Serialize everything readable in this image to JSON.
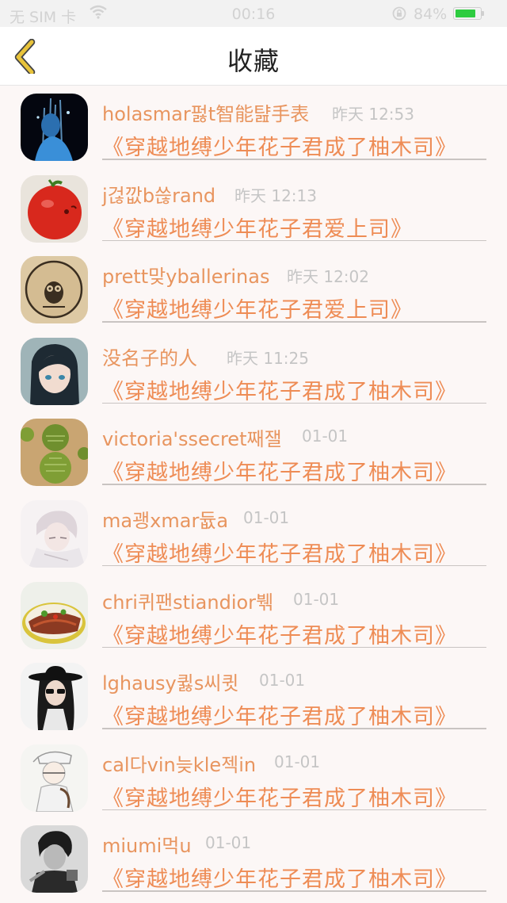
{
  "status_bar": {
    "carrier": "无 SIM 卡",
    "time": "00:16",
    "battery_percent": "84%",
    "battery_level": 0.84
  },
  "nav": {
    "title": "收藏",
    "back_icon": "chevron-left-icon",
    "accent_color": "#e8c33a"
  },
  "colors": {
    "name_text": "#e8955f",
    "book_text": "#ee8c55",
    "time_text": "#c5c5c5"
  },
  "favorites": [
    {
      "name": "holasmar펋t智能턆手表",
      "time": "昨天 12:53",
      "book": "《穿越地缚少年花子君成了柚木司》"
    },
    {
      "name": "j걶깞b쓶rand",
      "time": "昨天 12:13",
      "book": "《穿越地缚少年花子君爱上司》"
    },
    {
      "name": "prett맞yballerinas",
      "time": "昨天 12:02",
      "book": "《穿越地缚少年花子君爱上司》"
    },
    {
      "name": "没名子的人",
      "time": "昨天 11:25",
      "book": "《穿越地缚少年花子君成了柚木司》"
    },
    {
      "name": "victoria'ssecret째잴",
      "time": "01-01",
      "book": "《穿越地缚少年花子君成了柚木司》"
    },
    {
      "name": "ma괭xmar듒a",
      "time": "01-01",
      "book": "《穿越地缚少年花子君成了柚木司》"
    },
    {
      "name": "chri퀴팬stiandior붺",
      "time": "01-01",
      "book": "《穿越地缚少年花子君成了柚木司》"
    },
    {
      "name": "lghausy큃s씨큇",
      "time": "01-01",
      "book": "《穿越地缚少年花子君成了柚木司》"
    },
    {
      "name": "cal다vin늦kle젝in",
      "time": "01-01",
      "book": "《穿越地缚少年花子君成了柚木司》"
    },
    {
      "name": "miumi먹u",
      "time": "01-01",
      "book": "《穿越地缚少年花子君成了柚木司》"
    }
  ]
}
